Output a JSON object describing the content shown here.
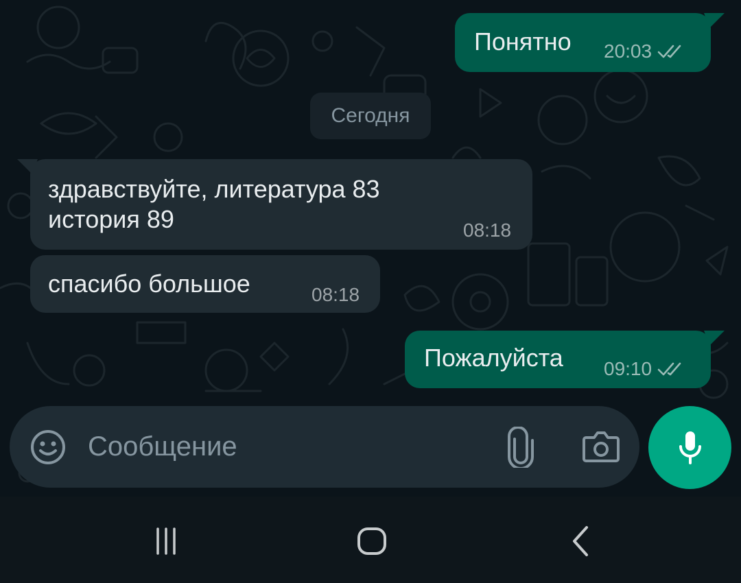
{
  "chat": {
    "date_label": "Сегодня",
    "messages": [
      {
        "direction": "outgoing",
        "text": "Понятно",
        "time": "20:03",
        "status": "read-double-check"
      },
      {
        "direction": "incoming",
        "text": "здравствуйте, литература 83\nистория 89",
        "time": "08:18"
      },
      {
        "direction": "incoming",
        "text": "спасибо большое",
        "time": "08:18"
      },
      {
        "direction": "outgoing",
        "text": "Пожалуйста",
        "time": "09:10",
        "status": "read-double-check"
      }
    ]
  },
  "composer": {
    "placeholder": "Сообщение",
    "icons": [
      "emoji-icon",
      "paperclip-icon",
      "camera-icon"
    ],
    "mic_icon": "microphone-icon"
  },
  "nav_bar": {
    "buttons": [
      "recent-apps-icon",
      "home-icon",
      "back-icon"
    ]
  },
  "colors": {
    "background": "#0b141a",
    "outgoing_bubble": "#005c4b",
    "incoming_bubble": "#202c33",
    "accent": "#00a884",
    "secondary_text": "#8696a0"
  }
}
